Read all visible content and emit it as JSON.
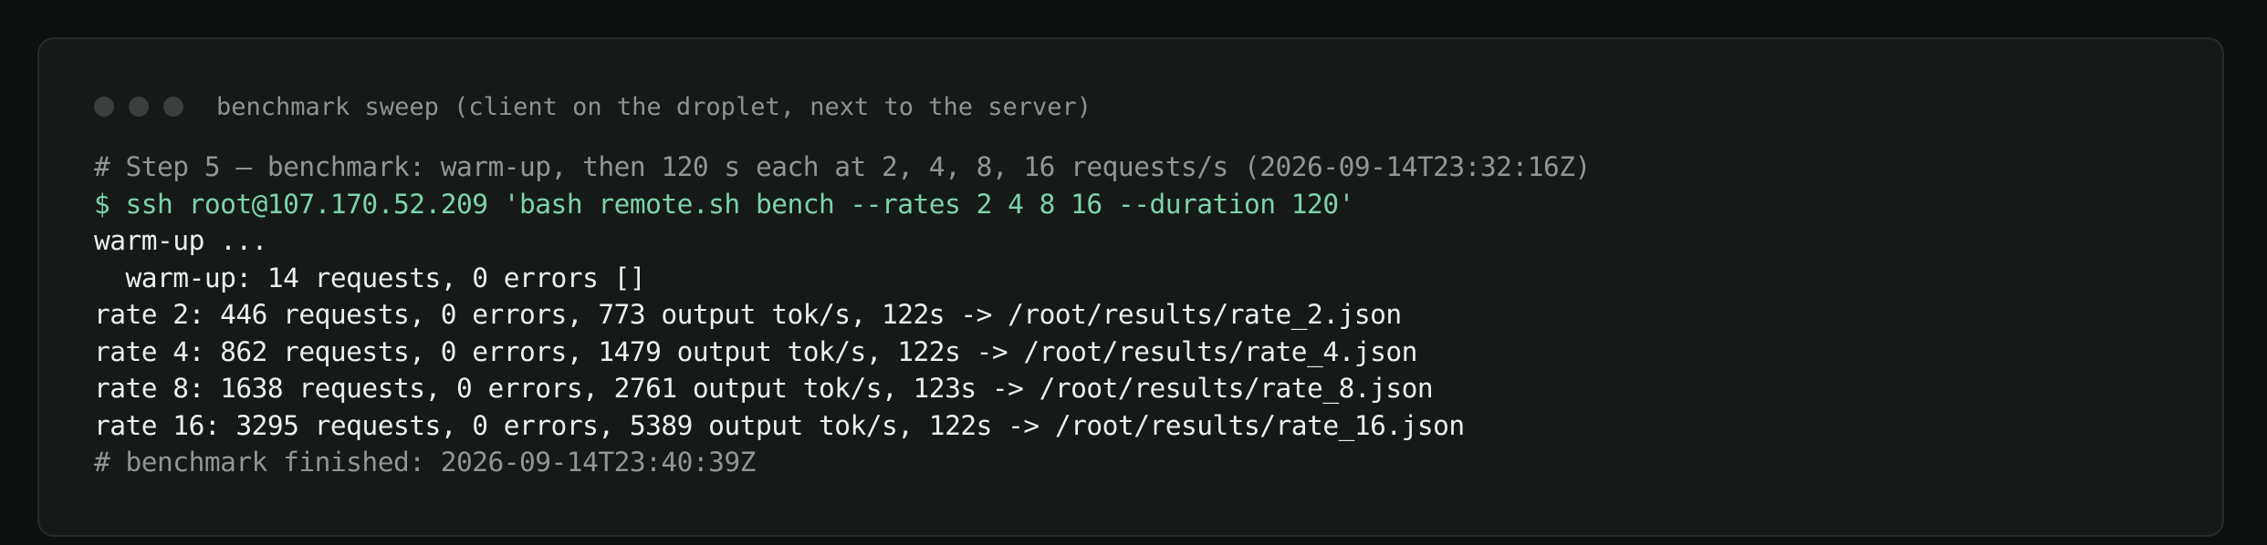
{
  "window": {
    "title": "benchmark sweep (client on the droplet, next to the server)"
  },
  "lines": [
    {
      "kind": "comment",
      "text": "# Step 5 — benchmark: warm-up, then 120 s each at 2, 4, 8, 16 requests/s (2026-09-14T23:32:16Z)"
    },
    {
      "kind": "command",
      "text": "$ ssh root@107.170.52.209 'bash remote.sh bench --rates 2 4 8 16 --duration 120'"
    },
    {
      "kind": "output",
      "text": "warm-up ..."
    },
    {
      "kind": "output",
      "text": "  warm-up: 14 requests, 0 errors []"
    },
    {
      "kind": "output",
      "text": "rate 2: 446 requests, 0 errors, 773 output tok/s, 122s -> /root/results/rate_2.json"
    },
    {
      "kind": "output",
      "text": "rate 4: 862 requests, 0 errors, 1479 output tok/s, 122s -> /root/results/rate_4.json"
    },
    {
      "kind": "output",
      "text": "rate 8: 1638 requests, 0 errors, 2761 output tok/s, 123s -> /root/results/rate_8.json"
    },
    {
      "kind": "output",
      "text": "rate 16: 3295 requests, 0 errors, 5389 output tok/s, 122s -> /root/results/rate_16.json"
    },
    {
      "kind": "comment",
      "text": "# benchmark finished: 2026-09-14T23:40:39Z"
    }
  ]
}
